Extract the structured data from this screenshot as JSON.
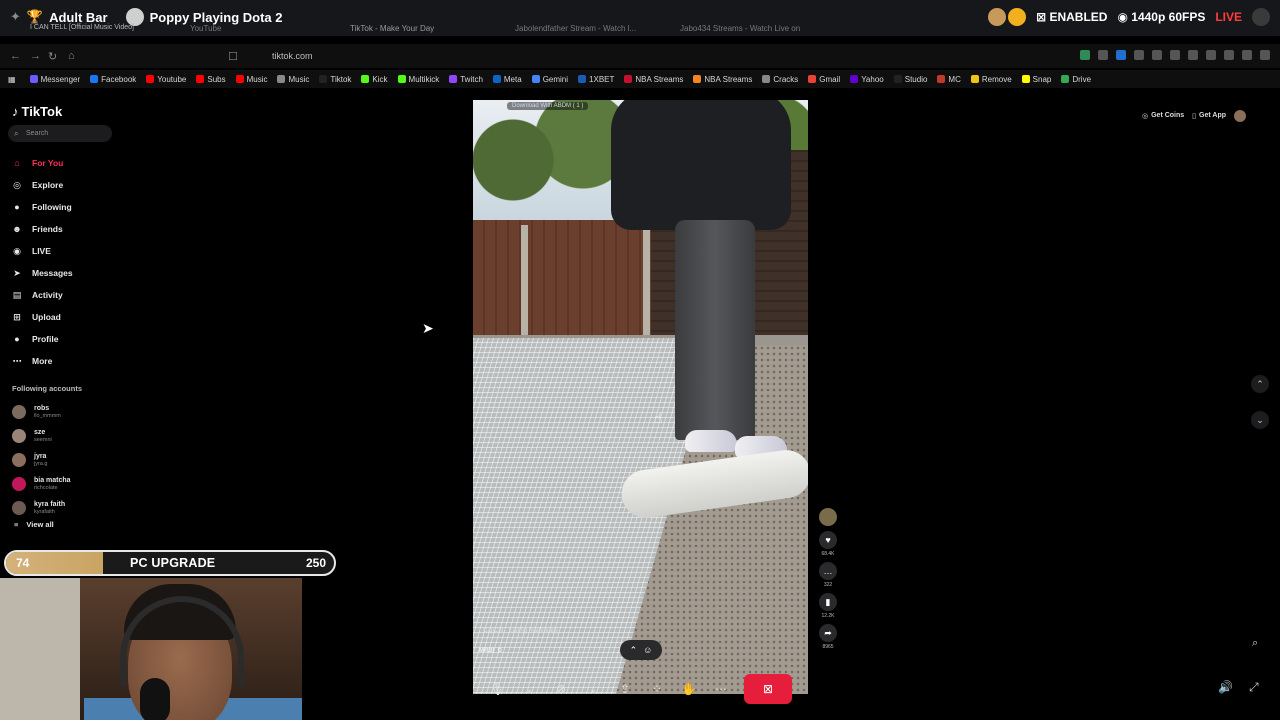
{
  "overlay": {
    "brand": "Adult Bar",
    "game_title": "Poppy Playing Dota 2",
    "now_playing": "I CAN TELL [Official Music Video]",
    "now_playing_sub": "I don't love you, p...",
    "status": "ENABLED",
    "quality": "1440p 60FPS",
    "live": "LIVE"
  },
  "browser": {
    "tabs": [
      "YouTube",
      "TikTok - Make Your Day",
      "Jabolendfather Stream - Watch l...",
      "Jabo434 Streams - Watch Live on"
    ],
    "url": "tiktok.com",
    "bookmarks": [
      {
        "label": "Messenger",
        "color": "#6b5cff"
      },
      {
        "label": "Facebook",
        "color": "#1877f2"
      },
      {
        "label": "Youtube",
        "color": "#ff0000"
      },
      {
        "label": "Subs",
        "color": "#ff0000"
      },
      {
        "label": "Music",
        "color": "#ff0000"
      },
      {
        "label": "Music",
        "color": "#888888"
      },
      {
        "label": "Tiktok",
        "color": "#222222"
      },
      {
        "label": "Kick",
        "color": "#53fc18"
      },
      {
        "label": "Multikick",
        "color": "#53fc18"
      },
      {
        "label": "Twitch",
        "color": "#9146ff"
      },
      {
        "label": "Meta",
        "color": "#0a66c2"
      },
      {
        "label": "Gemini",
        "color": "#4285f4"
      },
      {
        "label": "1XBET",
        "color": "#1a5bb5"
      },
      {
        "label": "NBA Streams",
        "color": "#c8102e"
      },
      {
        "label": "NBA Streams",
        "color": "#f58426"
      },
      {
        "label": "Cracks",
        "color": "#888888"
      },
      {
        "label": "Gmail",
        "color": "#ea4335"
      },
      {
        "label": "Yahoo",
        "color": "#6001d2"
      },
      {
        "label": "Studio",
        "color": "#222222"
      },
      {
        "label": "MC",
        "color": "#c0392b"
      },
      {
        "label": "Remove",
        "color": "#f1c40f"
      },
      {
        "label": "Snap",
        "color": "#fffc00"
      },
      {
        "label": "Drive",
        "color": "#34a853"
      }
    ]
  },
  "tiktok": {
    "logo": "TikTok",
    "search_placeholder": "Search",
    "nav": [
      {
        "label": "For You",
        "icon": "home-icon",
        "active": true
      },
      {
        "label": "Explore",
        "icon": "compass-icon"
      },
      {
        "label": "Following",
        "icon": "user-follow-icon"
      },
      {
        "label": "Friends",
        "icon": "friends-icon"
      },
      {
        "label": "LIVE",
        "icon": "live-icon"
      },
      {
        "label": "Messages",
        "icon": "send-icon"
      },
      {
        "label": "Activity",
        "icon": "inbox-icon"
      },
      {
        "label": "Upload",
        "icon": "plus-square-icon"
      },
      {
        "label": "Profile",
        "icon": "avatar-icon"
      },
      {
        "label": "More",
        "icon": "more-icon"
      }
    ],
    "following_header": "Following accounts",
    "following": [
      {
        "name": "robs",
        "sub": "llo_mmmm"
      },
      {
        "name": "sze",
        "sub": "seemni"
      },
      {
        "name": "jyra",
        "sub": "jyra.g"
      },
      {
        "name": "bia matcha",
        "sub": "richcolate"
      },
      {
        "name": "kyra faith",
        "sub": "kyrafaith"
      }
    ],
    "view_all": "View all",
    "get_coins": "Get Coins",
    "get_app": "Get App",
    "download_tag": "Download With ABDM ( 1 )",
    "caption_line": "CapCut · Editing made easy",
    "caption_user": "MRBI_D",
    "actions": {
      "likes": "68.4K",
      "comments": "322",
      "saves": "12.2K",
      "shares": "8965"
    }
  },
  "goal": {
    "current": "74",
    "title": "PC UPGRADE",
    "target": "250",
    "progress": 0.296
  }
}
